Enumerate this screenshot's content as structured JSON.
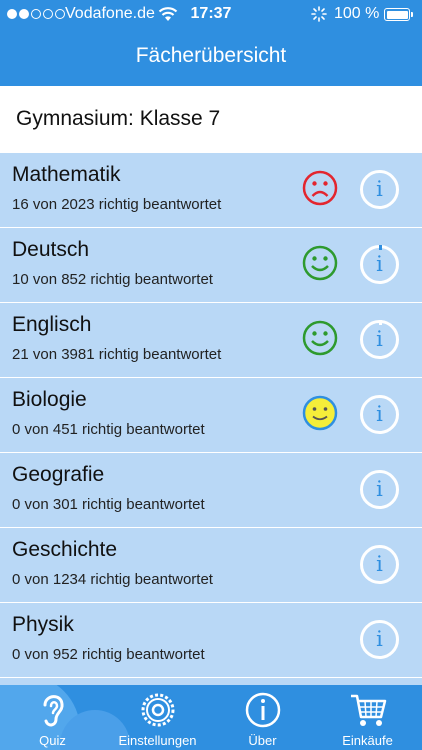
{
  "status_bar": {
    "carrier": "Vodafone.de",
    "time": "17:37",
    "battery": "100 %",
    "signal_bars_filled": 2,
    "signal_bars_total": 5
  },
  "nav": {
    "title": "Fächerübersicht"
  },
  "section": {
    "title": "Gymnasium: Klasse 7"
  },
  "subjects": [
    {
      "name": "Mathematik",
      "count": "16 von 2023 richtig beantwortet",
      "mood": "sad"
    },
    {
      "name": "Deutsch",
      "count": "10 von 852 richtig beantwortet",
      "mood": "happy"
    },
    {
      "name": "Englisch",
      "count": "21 von 3981 richtig beantwortet",
      "mood": "happy"
    },
    {
      "name": "Biologie",
      "count": "0 von 451 richtig beantwortet",
      "mood": "yellow"
    },
    {
      "name": "Geografie",
      "count": "0 von 301 richtig beantwortet",
      "mood": "none"
    },
    {
      "name": "Geschichte",
      "count": "0 von 1234 richtig beantwortet",
      "mood": "none"
    },
    {
      "name": "Physik",
      "count": "0 von 952 richtig beantwortet",
      "mood": "none"
    }
  ],
  "info_glyph": "i",
  "tabs": [
    {
      "label": "Quiz",
      "icon": "ear-icon",
      "active": true
    },
    {
      "label": "Einstellungen",
      "icon": "gear-icon",
      "active": false
    },
    {
      "label": "Über",
      "icon": "info-icon",
      "active": false
    },
    {
      "label": "Einkäufe",
      "icon": "cart-icon",
      "active": false
    }
  ],
  "colors": {
    "primary_blue": "#2f8fe0",
    "row_blue": "#b9d8f6",
    "sad_red": "#e3262f",
    "happy_green": "#2e9a2e",
    "neutral_yellow": "#f5ee3a"
  }
}
